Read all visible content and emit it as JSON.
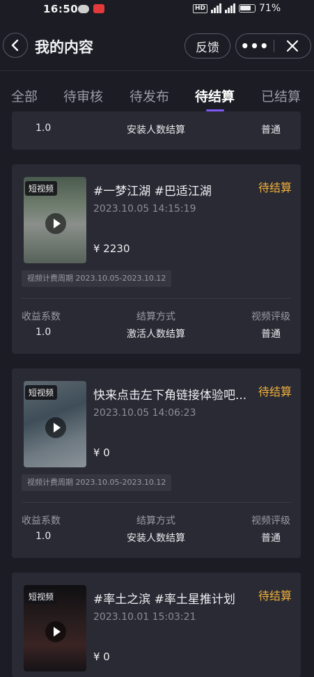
{
  "status_bar": {
    "time": "16:50",
    "network": "5G",
    "battery": "71%"
  },
  "header": {
    "title": "我的内容",
    "feedback_label": "反馈",
    "more_label": "•••"
  },
  "tabs": [
    {
      "label": "全部"
    },
    {
      "label": "待审核"
    },
    {
      "label": "待发布"
    },
    {
      "label": "待结算",
      "active": true
    },
    {
      "label": "已结算"
    }
  ],
  "labels": {
    "coef": "收益系数",
    "method": "结算方式",
    "rating": "视频评级",
    "thumb_tag": "短视频"
  },
  "partial_card": {
    "coef": "1.0",
    "method": "安装人数结算",
    "rating": "普通"
  },
  "cards": [
    {
      "title": "#一梦江湖 #巴适江湖",
      "status": "待结算",
      "date": "2023.10.05 14:15:19",
      "price": "¥ 2230",
      "period": "视频计费周期 2023.10.05-2023.10.12",
      "coef": "1.0",
      "method": "激活人数结算",
      "rating": "普通"
    },
    {
      "title": "快来点击左下角链接体验吧...",
      "status": "待结算",
      "date": "2023.10.05 14:06:23",
      "price": "¥ 0",
      "period": "视频计费周期 2023.10.05-2023.10.12",
      "coef": "1.0",
      "method": "安装人数结算",
      "rating": "普通"
    },
    {
      "title": "#率土之滨 #率土星推计划",
      "status": "待结算",
      "date": "2023.10.01 15:03:21",
      "price": "¥ 0"
    }
  ],
  "colors": {
    "accent": "#7e56f5",
    "status_pending": "#f3b13c",
    "background": "#1b1c24",
    "card": "#292a33"
  }
}
